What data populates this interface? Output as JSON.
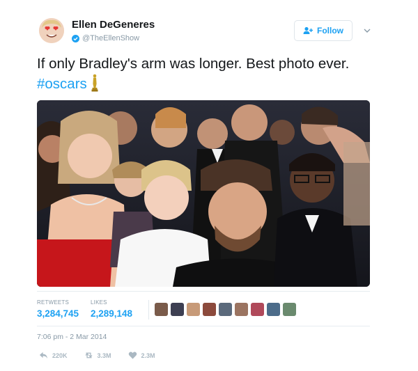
{
  "user": {
    "display_name": "Ellen DeGeneres",
    "handle": "@TheEllenShow",
    "verified": true,
    "avatar_icon": "emoji-heart-eyes-avatar"
  },
  "follow_button": {
    "label": "Follow",
    "icon": "add-person-icon"
  },
  "menu_icon": "chevron-down-icon",
  "tweet": {
    "text_before": "If only Bradley's arm was longer. Best photo ever. ",
    "hashtag": "#oscars",
    "trailing_icon": "oscar-statue-icon"
  },
  "photo": {
    "icon": "group-selfie-photo"
  },
  "stats": {
    "retweets_label": "RETWEETS",
    "retweets_count": "3,284,745",
    "likes_label": "LIKES",
    "likes_count": "2,289,148",
    "liker_avatars": [
      "#7a5b4a",
      "#3d3f52",
      "#c79a78",
      "#8c4a3c",
      "#5b6a7c",
      "#9b7461",
      "#b0495a",
      "#4c6c8a",
      "#6a8a6e"
    ]
  },
  "timestamp": "7:06 pm - 2 Mar 2014",
  "actions": {
    "reply_count": "220K",
    "retweet_count": "3.3M",
    "like_count": "2.3M"
  },
  "colors": {
    "link_blue": "#1da1f2",
    "muted": "#8899a6",
    "text": "#14171a"
  }
}
